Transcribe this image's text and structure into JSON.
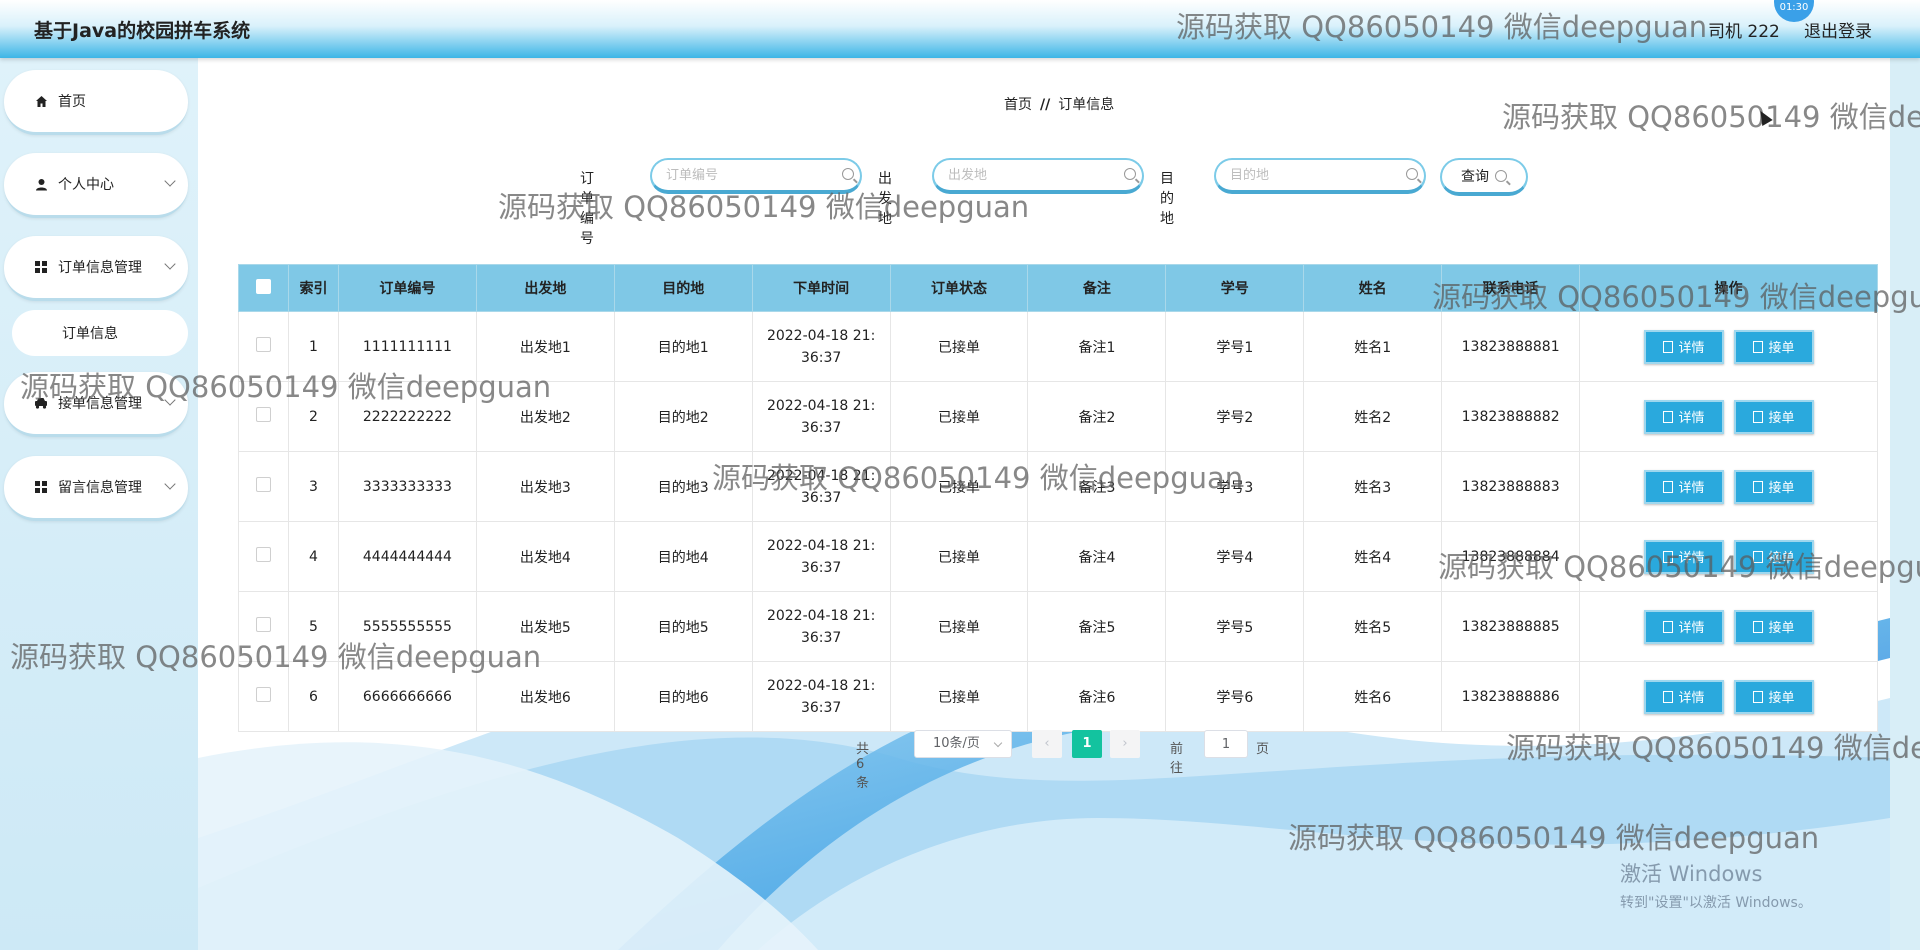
{
  "header": {
    "title": "基于Java的校园拼车系统",
    "user": "司机 222",
    "logout": "退出登录",
    "avatar_time": "01:30"
  },
  "sidebar": {
    "items": [
      {
        "label": "首页",
        "icon": "home-icon"
      },
      {
        "label": "个人中心",
        "icon": "user-icon"
      },
      {
        "label": "订单信息管理",
        "icon": "grid-icon"
      },
      {
        "label": "订单信息",
        "icon": ""
      },
      {
        "label": "接单信息管理",
        "icon": "car-icon"
      },
      {
        "label": "留言信息管理",
        "icon": "grid-icon"
      }
    ]
  },
  "breadcrumb": {
    "home": "首页",
    "separator": "//",
    "current": "订单信息"
  },
  "search": {
    "order_no_label": "订单编号",
    "order_no_placeholder": "订单编号",
    "from_label": "出发地",
    "from_placeholder": "出发地",
    "to_label": "目的地",
    "to_placeholder": "目的地",
    "query_label": "查询"
  },
  "table": {
    "headers": [
      "索引",
      "订单编号",
      "出发地",
      "目的地",
      "下单时间",
      "订单状态",
      "备注",
      "学号",
      "姓名",
      "联系电话",
      "操作"
    ],
    "detail_label": "详情",
    "accept_label": "接单",
    "rows": [
      {
        "idx": "1",
        "order_no": "1111111111",
        "from": "出发地1",
        "to": "目的地1",
        "time": "2022-04-18 21:36:37",
        "status": "已接单",
        "remark": "备注1",
        "student_no": "学号1",
        "name": "姓名1",
        "phone": "13823888881"
      },
      {
        "idx": "2",
        "order_no": "2222222222",
        "from": "出发地2",
        "to": "目的地2",
        "time": "2022-04-18 21:36:37",
        "status": "已接单",
        "remark": "备注2",
        "student_no": "学号2",
        "name": "姓名2",
        "phone": "13823888882"
      },
      {
        "idx": "3",
        "order_no": "3333333333",
        "from": "出发地3",
        "to": "目的地3",
        "time": "2022-04-18 21:36:37",
        "status": "已接单",
        "remark": "备注3",
        "student_no": "学号3",
        "name": "姓名3",
        "phone": "13823888883"
      },
      {
        "idx": "4",
        "order_no": "4444444444",
        "from": "出发地4",
        "to": "目的地4",
        "time": "2022-04-18 21:36:37",
        "status": "已接单",
        "remark": "备注4",
        "student_no": "学号4",
        "name": "姓名4",
        "phone": "13823888884"
      },
      {
        "idx": "5",
        "order_no": "5555555555",
        "from": "出发地5",
        "to": "目的地5",
        "time": "2022-04-18 21:36:37",
        "status": "已接单",
        "remark": "备注5",
        "student_no": "学号5",
        "name": "姓名5",
        "phone": "13823888885"
      },
      {
        "idx": "6",
        "order_no": "6666666666",
        "from": "出发地6",
        "to": "目的地6",
        "time": "2022-04-18 21:36:37",
        "status": "已接单",
        "remark": "备注6",
        "student_no": "学号6",
        "name": "姓名6",
        "phone": "13823888886"
      }
    ]
  },
  "pagination": {
    "total_text": "共 6 条",
    "page_size": "10条/页",
    "current_page": "1",
    "goto_label": "前往",
    "goto_value": "1",
    "page_unit": "页"
  },
  "watermark": {
    "text": "源码获取 QQ86050149 微信deepguan"
  },
  "windows": {
    "line1": "激活 Windows",
    "line2": "转到\"设置\"以激活 Windows。"
  },
  "colors": {
    "header_blue": "#3db5e6",
    "table_header": "#7fc8e6",
    "action_button": "#2aa9dd",
    "page_active": "#13c39f"
  }
}
